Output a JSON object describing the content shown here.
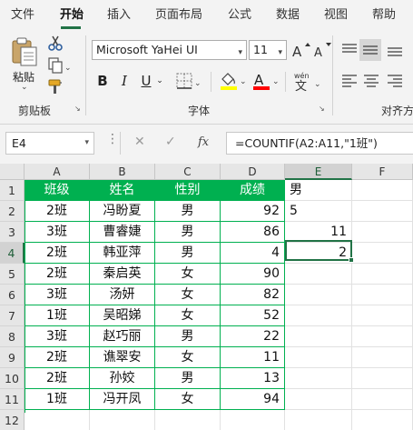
{
  "ribbon": {
    "tabs": [
      "文件",
      "开始",
      "插入",
      "页面布局",
      "公式",
      "数据",
      "视图",
      "帮助"
    ],
    "active_tab": "开始",
    "clipboard": {
      "paste_label": "粘贴",
      "group_label": "剪贴板"
    },
    "font": {
      "name": "Microsoft YaHei UI",
      "size": "11",
      "group_label": "字体",
      "bold_glyph": "B",
      "italic_glyph": "I",
      "underline_glyph": "U",
      "font_color": "#ff0000",
      "fill_color": "#ffff00",
      "phonetic_glyph": "wén"
    },
    "alignment": {
      "group_label": "对齐方"
    }
  },
  "formula_bar": {
    "name_box": "E4",
    "cancel_glyph": "✕",
    "enter_glyph": "✓",
    "fx_glyph": "fx",
    "formula": "=COUNTIF(A2:A11,\"1班\")"
  },
  "grid": {
    "columns": [
      "A",
      "B",
      "C",
      "D",
      "E",
      "F"
    ],
    "rows": [
      "1",
      "2",
      "3",
      "4",
      "5",
      "6",
      "7",
      "8",
      "9",
      "10",
      "11",
      "12"
    ],
    "selected_column": "E",
    "selected_row": "4",
    "table_header": [
      "班级",
      "姓名",
      "性别",
      "成绩"
    ],
    "table_rows": [
      [
        "2班",
        "冯盼夏",
        "男",
        "92"
      ],
      [
        "3班",
        "曹睿婕",
        "男",
        "86"
      ],
      [
        "2班",
        "韩亚萍",
        "男",
        "4"
      ],
      [
        "2班",
        "秦启英",
        "女",
        "90"
      ],
      [
        "3班",
        "汤妍",
        "女",
        "82"
      ],
      [
        "1班",
        "吴昭娣",
        "女",
        "52"
      ],
      [
        "3班",
        "赵巧丽",
        "男",
        "22"
      ],
      [
        "2班",
        "谯翠安",
        "女",
        "11"
      ],
      [
        "2班",
        "孙姣",
        "男",
        "13"
      ],
      [
        "1班",
        "冯开凤",
        "女",
        "94"
      ]
    ],
    "col_e": [
      "男",
      "5",
      "11",
      "2"
    ],
    "accent_color": "#00b050"
  }
}
